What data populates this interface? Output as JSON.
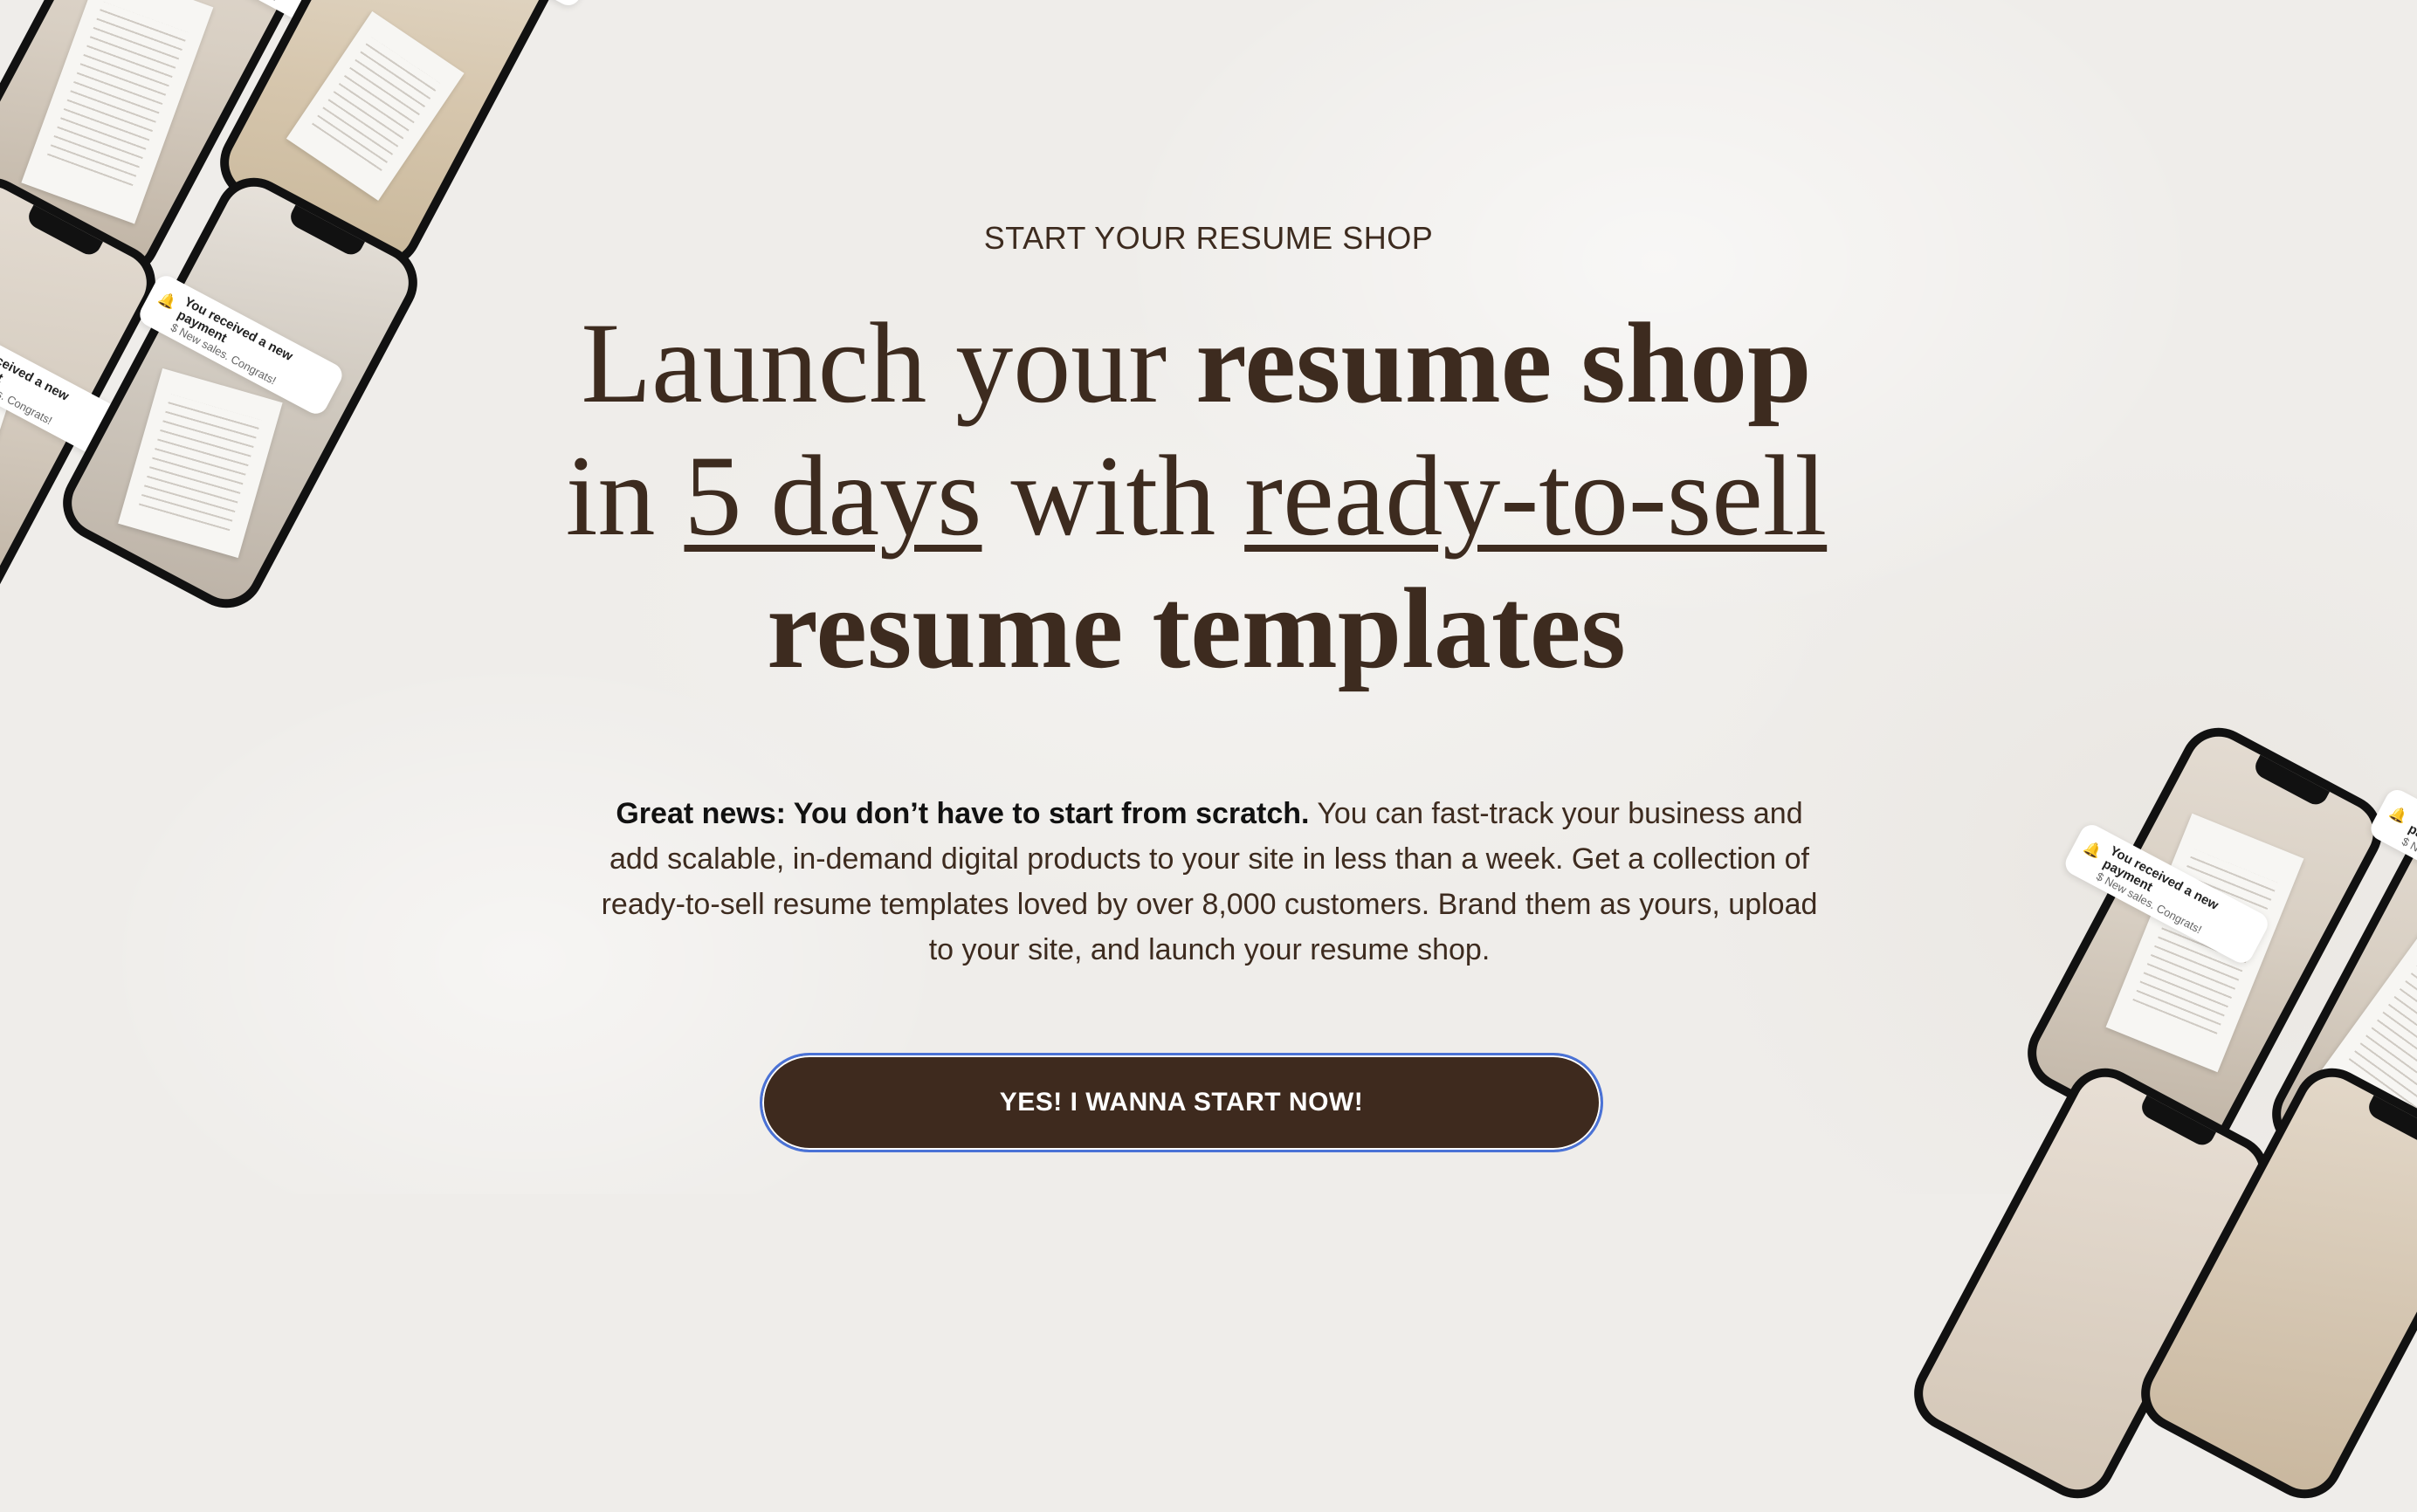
{
  "hero": {
    "eyebrow": "START YOUR RESUME SHOP",
    "headline": {
      "p1": "Launch your ",
      "p1_bold": "resume shop",
      "p2": "in ",
      "p2_ul": "5 days",
      "p3": " with ",
      "p3_ul": "ready-to-sell",
      "p4_bold": "resume templates"
    },
    "body": {
      "lead": "Great news: You don’t have to start from scratch.",
      "text": " You can fast-track your business and add scalable, in-demand digital products to your site in less than a week. Get a collection of ready-to-sell resume templates loved by over 8,000 customers. Brand them as yours, upload to your site, and launch your resume shop."
    },
    "cta_label": "YES! I WANNA START NOW!"
  },
  "notification": {
    "title": "You received a new payment",
    "subtitle": "$ New sales. Congrats!",
    "icon": "bell-icon"
  },
  "colors": {
    "background": "#efedea",
    "brand_brown": "#3e2a1e",
    "focus_ring": "#4a72d6"
  }
}
